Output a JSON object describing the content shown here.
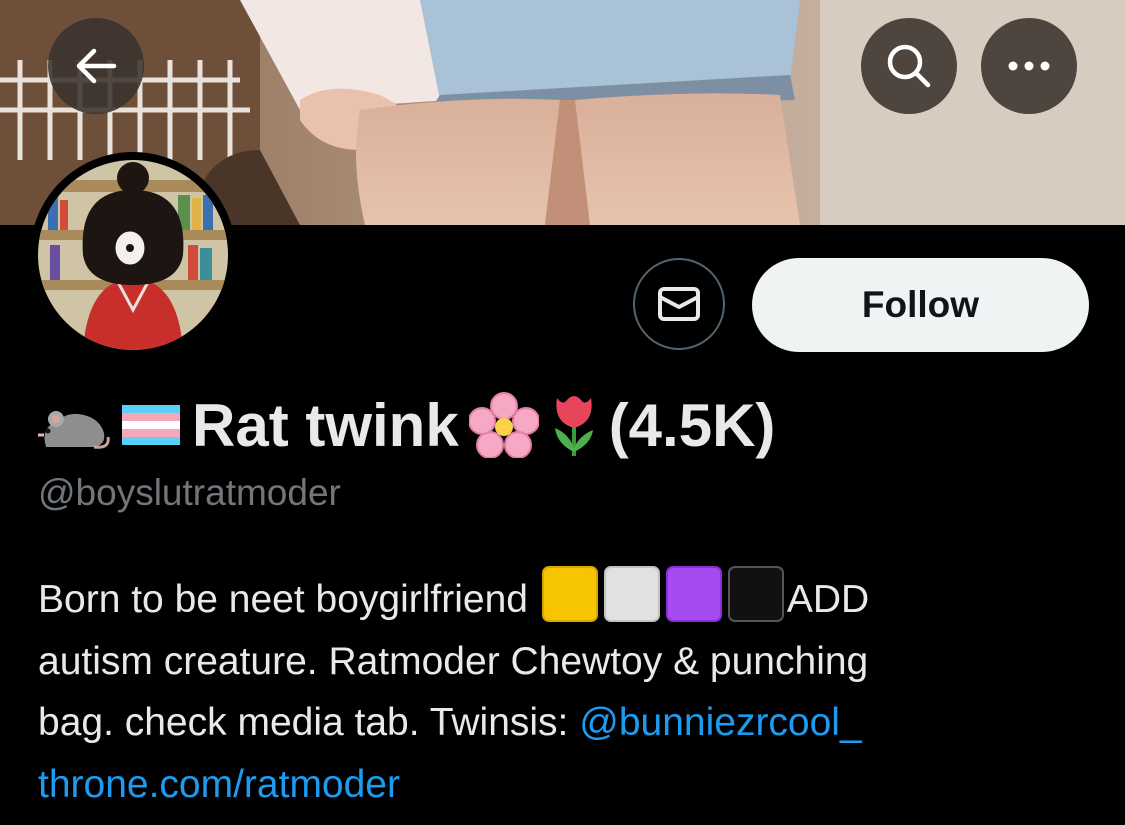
{
  "header": {
    "back_icon": "arrow-left-icon",
    "search_icon": "search-icon",
    "more_icon": "more-horizontal-icon"
  },
  "profile": {
    "display_name_text": "Rat twink",
    "display_name_count": "(4.5K)",
    "display_name_emojis": [
      "rat-emoji",
      "transgender-flag-emoji",
      "cherry-blossom-emoji",
      "tulip-emoji"
    ],
    "handle": "@boyslutratmoder",
    "message_icon": "envelope-icon",
    "follow_label": "Follow"
  },
  "bio": {
    "line1_text": "Born to be neet boygirlfriend",
    "line1_squares": [
      "yellow-square",
      "white-square",
      "purple-square",
      "black-square"
    ],
    "line1_tail": "ADD",
    "line2": "autism creature. Ratmoder Chewtoy & punching",
    "line3_text": "bag. check media tab. Twinsis: ",
    "line3_mention": "@bunniezrcool_",
    "link": "throne.com/ratmoder"
  },
  "colors": {
    "background": "#000000",
    "primary_text": "#e7e9ea",
    "secondary_text": "#71767b",
    "link": "#1d9bf0",
    "follow_bg": "#eff3f4",
    "follow_text": "#0f1419"
  }
}
